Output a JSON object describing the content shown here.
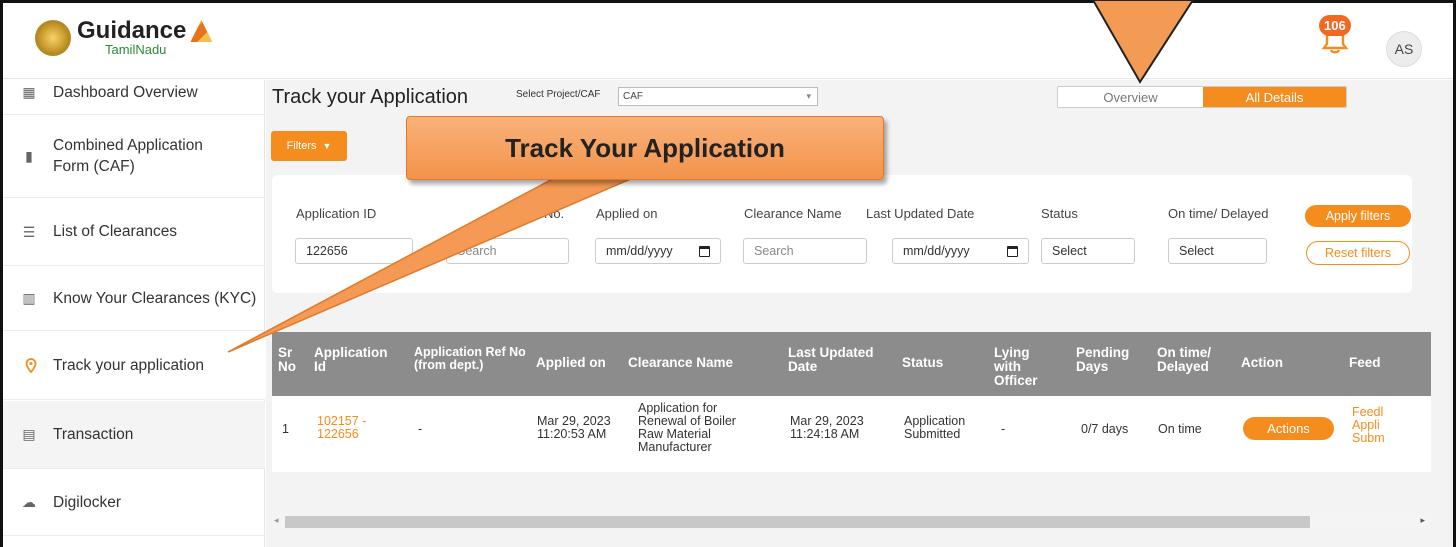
{
  "header": {
    "logo_title": "Guidance",
    "logo_sub": "TamilNadu",
    "notification_count": "106",
    "avatar_initials": "AS"
  },
  "sidebar": {
    "items": [
      {
        "label": "Dashboard Overview",
        "icon": "dashboard-icon"
      },
      {
        "label": "Combined Application Form (CAF)",
        "icon": "document-icon"
      },
      {
        "label": "List of Clearances",
        "icon": "list-icon"
      },
      {
        "label": "Know Your Clearances (KYC)",
        "icon": "book-icon"
      },
      {
        "label": "Track your application",
        "icon": "location-pin-icon"
      },
      {
        "label": "Transaction",
        "icon": "transaction-icon"
      },
      {
        "label": "Digilocker",
        "icon": "cloud-icon"
      }
    ]
  },
  "main": {
    "title": "Track your Application",
    "project_label": "Select Project/CAF",
    "project_value": "CAF",
    "view_toggle": {
      "overview": "Overview",
      "all_details": "All Details"
    },
    "filters_button": "Filters",
    "callout": "Track Your Application"
  },
  "filters": {
    "application_id": {
      "label": "Application ID",
      "value": "122656"
    },
    "ref_no": {
      "label": "No.",
      "placeholder": "Search"
    },
    "applied_on": {
      "label": "Applied on",
      "value": "mm/dd/yyyy"
    },
    "clearance_name": {
      "label": "Clearance Name",
      "placeholder": "Search"
    },
    "last_updated": {
      "label": "Last Updated Date",
      "value": "mm/dd/yyyy"
    },
    "status": {
      "label": "Status",
      "value": "Select"
    },
    "on_time": {
      "label": "On time/ Delayed",
      "value": "Select"
    },
    "apply": "Apply filters",
    "reset": "Reset filters"
  },
  "table": {
    "headers": [
      "Sr No",
      "Application Id",
      "Application Ref No (from dept.)",
      "Applied on",
      "Clearance Name",
      "Last Updated Date",
      "Status",
      "Lying with Officer",
      "Pending Days",
      "On time/ Delayed",
      "Action",
      "Feed"
    ],
    "rows": [
      {
        "sr": "1",
        "app_id": "102157 - 122656",
        "ref_no": "-",
        "applied_on": "Mar 29, 2023 11:20:53 AM",
        "clearance": "Application for Renewal of Boiler Raw Material Manufacturer",
        "last_updated": "Mar 29, 2023 11:24:18 AM",
        "status": "Application Submitted",
        "lying_with": "-",
        "pending": "0/7 days",
        "on_time": "On time",
        "action": "Actions",
        "feedback": "Feedl Appli Subm"
      }
    ]
  },
  "colors": {
    "accent": "#f58c1e",
    "table_header": "#8c8c8c",
    "main_bg": "#f3f3f3"
  }
}
